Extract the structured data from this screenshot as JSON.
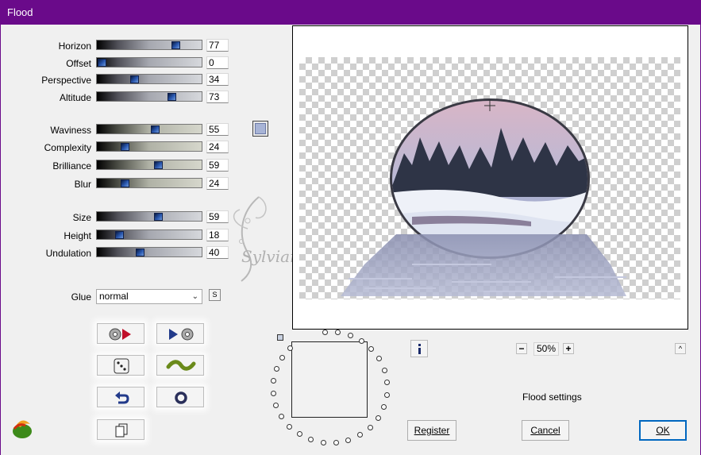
{
  "window": {
    "title": "Flood"
  },
  "sliders": [
    {
      "id": "horizon",
      "label": "Horizon",
      "value": 77
    },
    {
      "id": "offset",
      "label": "Offset",
      "value": 0
    },
    {
      "id": "perspective",
      "label": "Perspective",
      "value": 34
    },
    {
      "id": "altitude",
      "label": "Altitude",
      "value": 73
    },
    {
      "id": "waviness",
      "label": "Waviness",
      "value": 55
    },
    {
      "id": "complexity",
      "label": "Complexity",
      "value": 24
    },
    {
      "id": "brilliance",
      "label": "Brilliance",
      "value": 59
    },
    {
      "id": "blur",
      "label": "Blur",
      "value": 24
    },
    {
      "id": "size",
      "label": "Size",
      "value": 59
    },
    {
      "id": "height",
      "label": "Height",
      "value": 18
    },
    {
      "id": "undulation",
      "label": "Undulation",
      "value": 40
    }
  ],
  "slider_max": 100,
  "color_swatch": {
    "color": "#a8b4d6"
  },
  "glue": {
    "label": "Glue",
    "value": "normal",
    "side_button": "S"
  },
  "tool_buttons": [
    {
      "id": "load-preset",
      "icon": "disc-arrow-right-icon"
    },
    {
      "id": "save-preset",
      "icon": "arrow-right-disc-icon"
    },
    {
      "id": "randomize",
      "icon": "dice-icon"
    },
    {
      "id": "wave",
      "icon": "wave-icon"
    },
    {
      "id": "undo",
      "icon": "undo-arrow-icon"
    },
    {
      "id": "reset",
      "icon": "ring-icon"
    },
    {
      "id": "copy",
      "icon": "copy-pages-icon"
    }
  ],
  "preview": {
    "watermark": "Sylviane"
  },
  "zoom": {
    "value": "50%",
    "minus": "−",
    "plus": "+"
  },
  "status": {
    "text": "Flood settings"
  },
  "buttons": {
    "register": "Register",
    "cancel": "Cancel",
    "ok": "OK"
  },
  "icons": {
    "info": "info-icon",
    "collapse": "caret-up-icon",
    "logo": "filter-logo-icon"
  }
}
